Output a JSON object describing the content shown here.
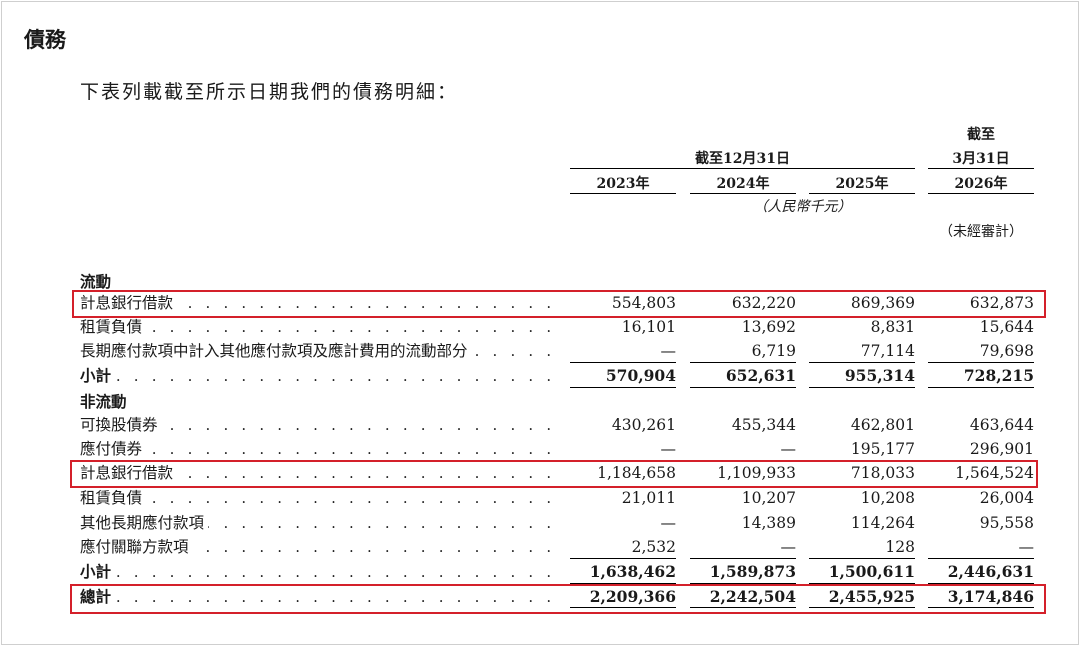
{
  "heading": "債務",
  "intro": "下表列載截至所示日期我們的債務明細：",
  "header": {
    "group1": "截至12月31日",
    "group2_line1": "截至",
    "group2_line2": "3月31日",
    "years": [
      "2023年",
      "2024年",
      "2025年",
      "2026年"
    ],
    "unit": "（人民幣千元）",
    "unaudited": "（未經審計）"
  },
  "sections": {
    "current": "流動",
    "noncurrent": "非流動"
  },
  "rows": [
    {
      "label": "計息銀行借款",
      "values": [
        "554,803",
        "632,220",
        "869,369",
        "632,873"
      ]
    },
    {
      "label": "租賃負債",
      "values": [
        "16,101",
        "13,692",
        "8,831",
        "15,644"
      ]
    },
    {
      "label": "長期應付款項中計入其他應付款項及應計費用的流動部分",
      "values": [
        "—",
        "6,719",
        "77,114",
        "79,698"
      ]
    },
    {
      "label": "小計",
      "values": [
        "570,904",
        "652,631",
        "955,314",
        "728,215"
      ]
    },
    {
      "label": "可換股債券",
      "values": [
        "430,261",
        "455,344",
        "462,801",
        "463,644"
      ]
    },
    {
      "label": "應付債券",
      "values": [
        "—",
        "—",
        "195,177",
        "296,901"
      ]
    },
    {
      "label": "計息銀行借款",
      "values": [
        "1,184,658",
        "1,109,933",
        "718,033",
        "1,564,524"
      ]
    },
    {
      "label": "租賃負債",
      "values": [
        "21,011",
        "10,207",
        "10,208",
        "26,004"
      ]
    },
    {
      "label": "其他長期應付款項",
      "values": [
        "—",
        "14,389",
        "114,264",
        "95,558"
      ]
    },
    {
      "label": "應付關聯方款項",
      "values": [
        "2,532",
        "—",
        "128",
        "—"
      ]
    },
    {
      "label": "小計",
      "values": [
        "1,638,462",
        "1,589,873",
        "1,500,611",
        "2,446,631"
      ]
    },
    {
      "label": "總計",
      "values": [
        "2,209,366",
        "2,242,504",
        "2,455,925",
        "3,174,846"
      ]
    }
  ],
  "highlight_color": "#d4202a"
}
